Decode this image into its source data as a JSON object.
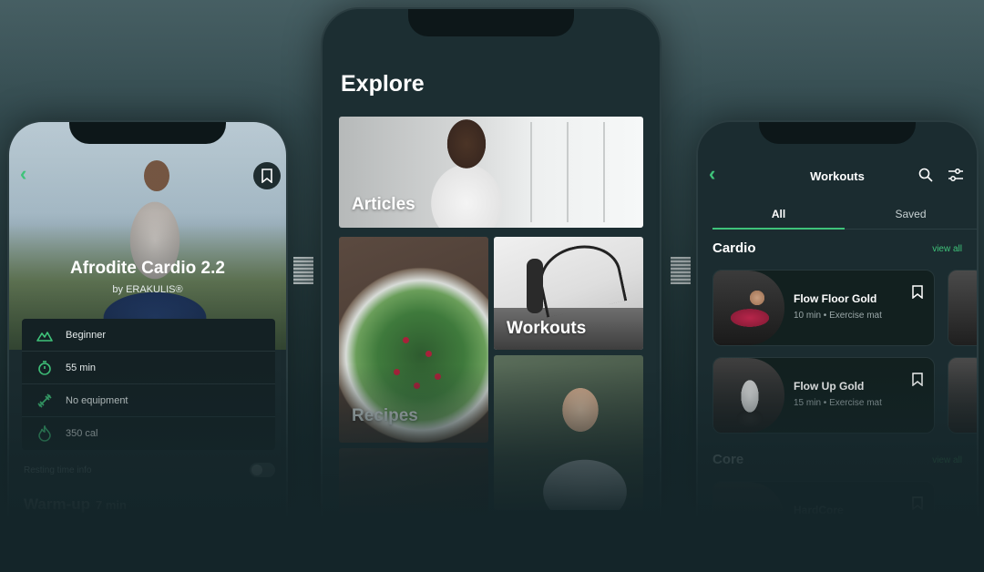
{
  "left_screen": {
    "title": "Afrodite Cardio 2.2",
    "byline": "by ERAKULIS®",
    "details": [
      {
        "icon": "mountain-icon",
        "label": "Beginner"
      },
      {
        "icon": "stopwatch-icon",
        "label": "55 min"
      },
      {
        "icon": "dumbbell-icon",
        "label": "No equipment"
      },
      {
        "icon": "flame-icon",
        "label": "350 cal"
      }
    ],
    "rest_label": "Resting time info",
    "section_title": "Warm-up",
    "section_duration": "7 min"
  },
  "center_screen": {
    "title": "Explore",
    "cards": {
      "articles": "Articles",
      "workouts": "Workouts",
      "recipes": "Recipes"
    }
  },
  "right_screen": {
    "title": "Workouts",
    "tabs": [
      "All",
      "Saved"
    ],
    "active_tab": "All",
    "sections": [
      {
        "title": "Cardio",
        "view_all": "view all",
        "items": [
          {
            "name": "Flow Floor Gold",
            "meta": "10 min • Exercise mat"
          },
          {
            "name": "Flow Up Gold",
            "meta": "15 min • Exercise mat"
          }
        ]
      },
      {
        "title": "Core",
        "view_all": "view all",
        "items": [
          {
            "name": "HardCore",
            "meta": ""
          }
        ]
      }
    ]
  },
  "colors": {
    "accent": "#3fc37a",
    "screen_bg": "#1b2b2f",
    "page_bg": "#2e4549"
  }
}
